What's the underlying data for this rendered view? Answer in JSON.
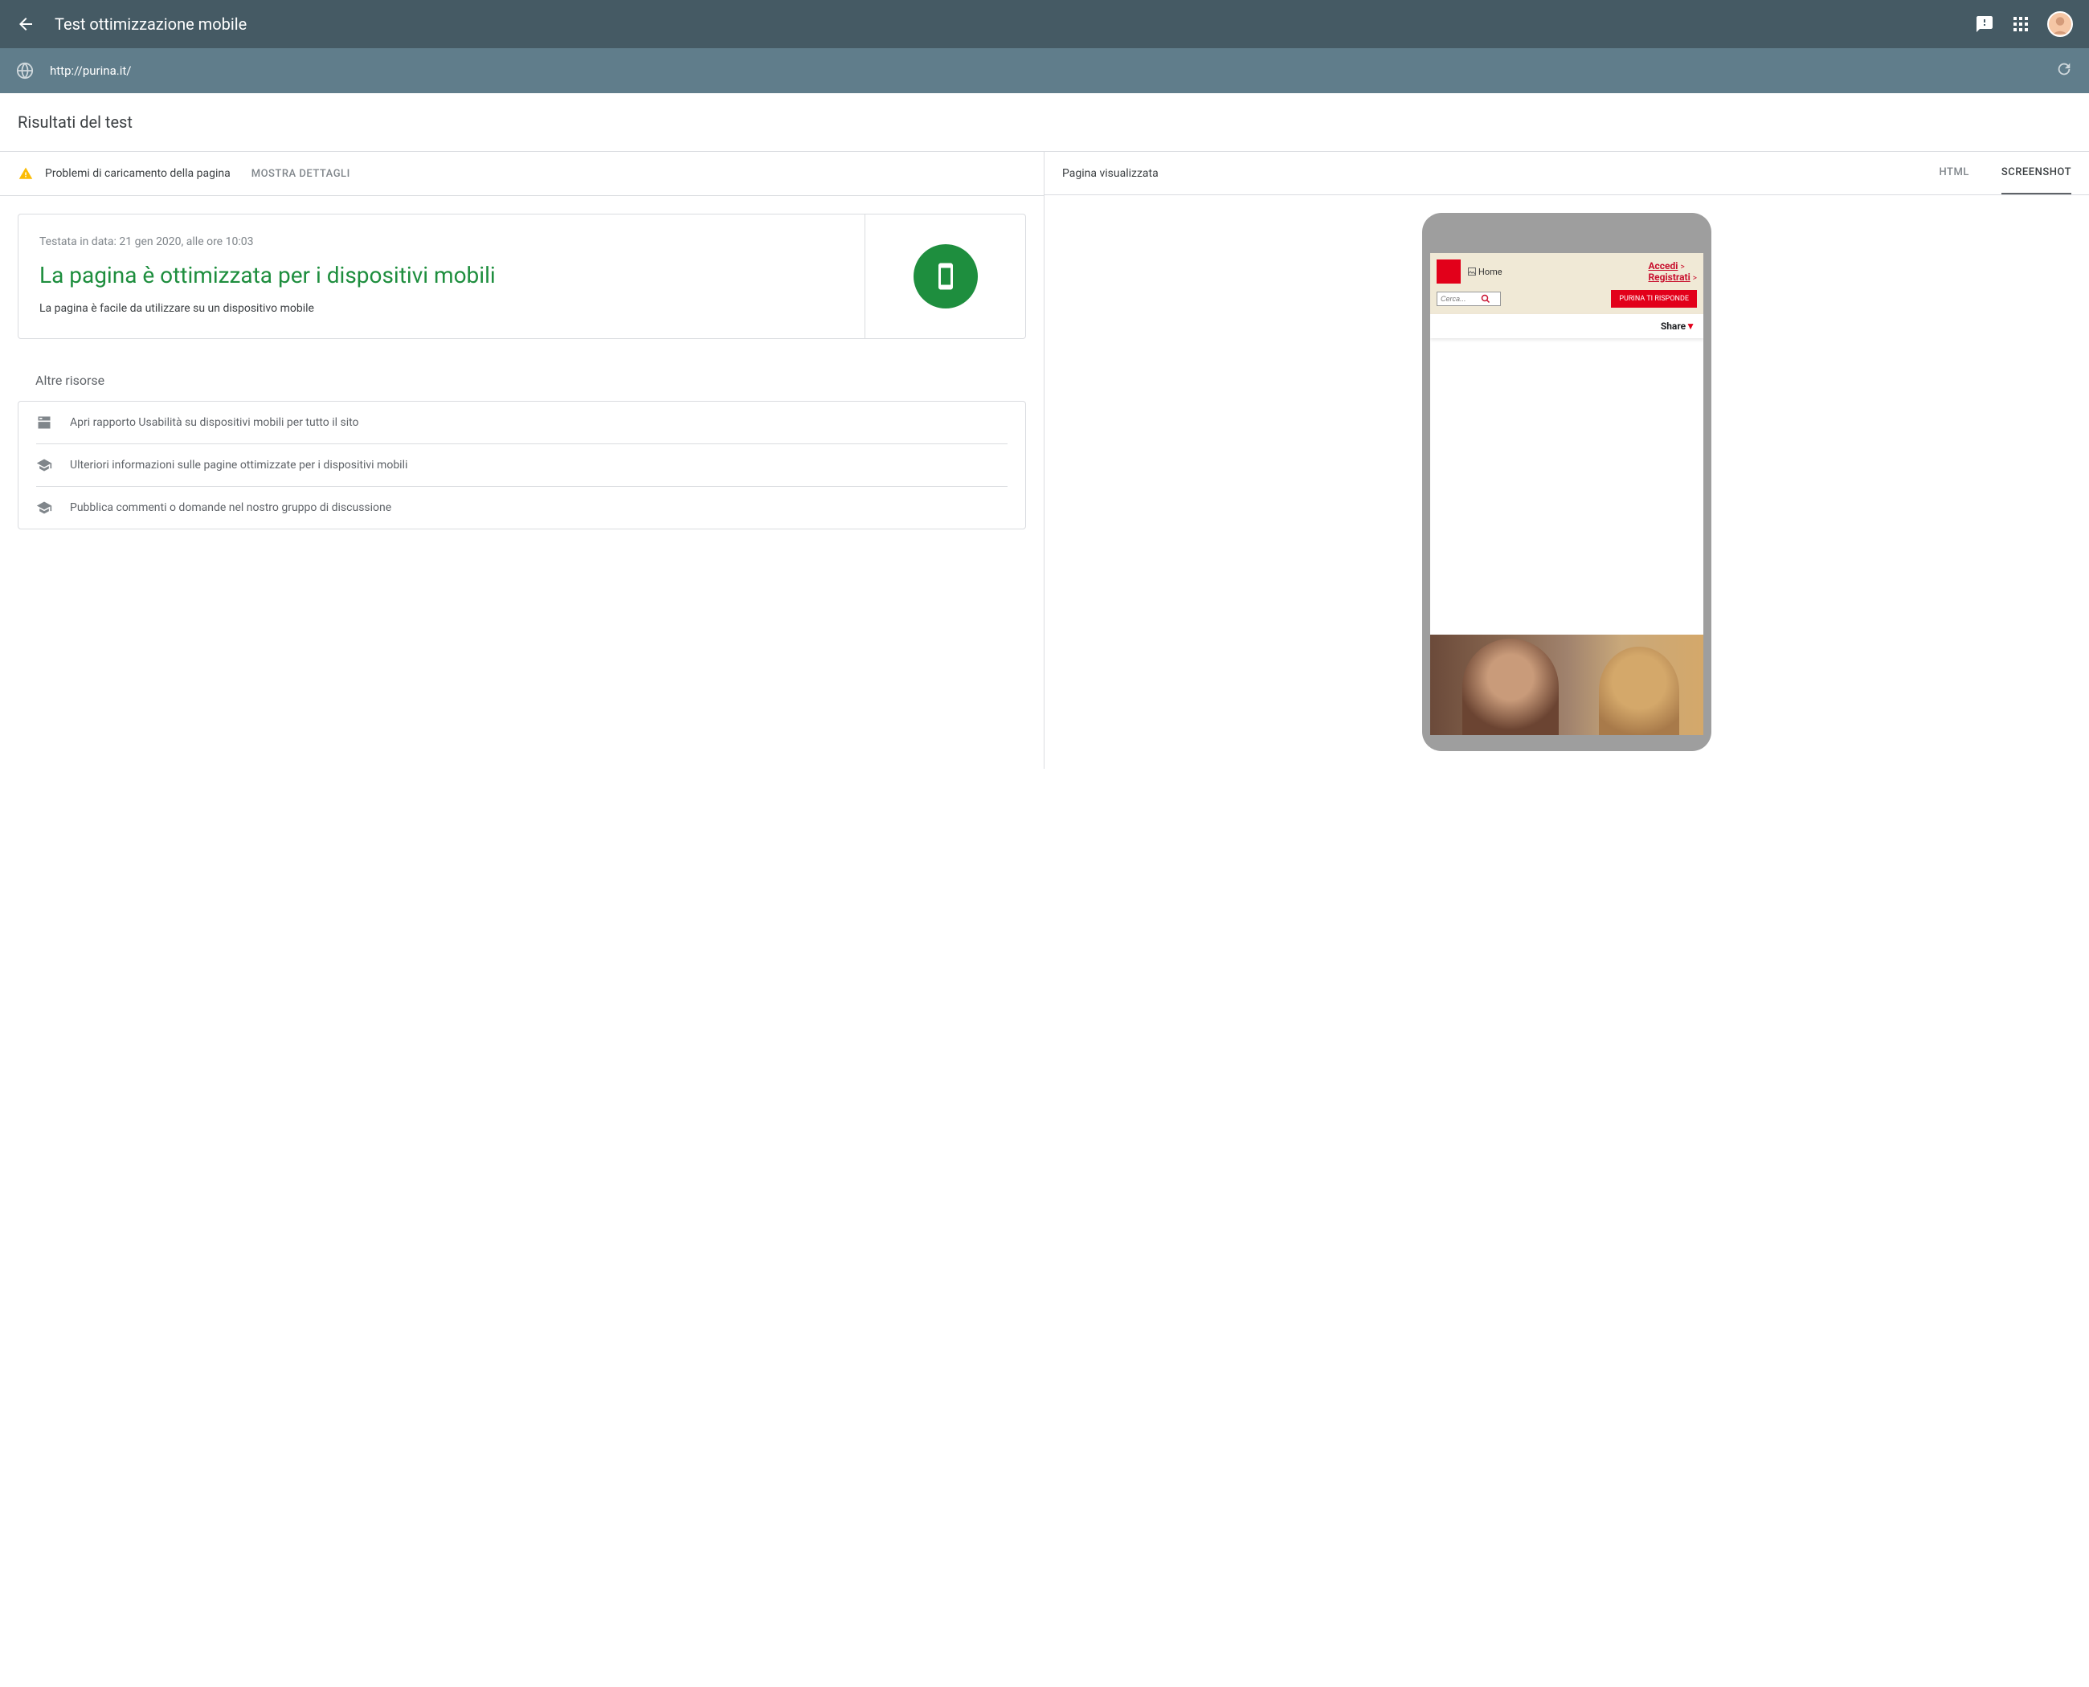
{
  "header": {
    "title": "Test ottimizzazione mobile"
  },
  "url_bar": {
    "url": "http://purina.it/"
  },
  "section_title": "Risultati del test",
  "loading_issues": {
    "text": "Problemi di caricamento della pagina",
    "details": "MOSTRA DETTAGLI"
  },
  "result": {
    "tested": "Testata in data: 21 gen 2020, alle ore 10:03",
    "heading": "La pagina è ottimizzata per i dispositivi mobili",
    "description": "La pagina è facile da utilizzare su un dispositivo mobile"
  },
  "other_resources": {
    "title": "Altre risorse",
    "items": [
      "Apri rapporto Usabilità su dispositivi mobili per tutto il sito",
      "Ulteriori informazioni sulle pagine ottimizzate per i dispositivi mobili",
      "Pubblica commenti o domande nel nostro gruppo di discussione"
    ]
  },
  "right": {
    "title": "Pagina visualizzata",
    "tabs": {
      "html": "HTML",
      "screenshot": "SCREENSHOT"
    }
  },
  "preview": {
    "home_alt": "Home",
    "accedi": "Accedi",
    "registrati": "Registrati",
    "search_placeholder": "Cerca...",
    "button": "PURINA TI RISPONDE",
    "share": "Share"
  }
}
